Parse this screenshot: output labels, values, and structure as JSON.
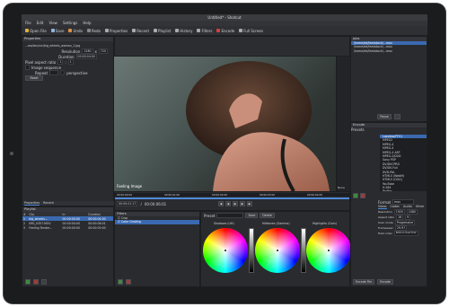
{
  "window": {
    "title": "Untitled* - Shotcut"
  },
  "menu": [
    "File",
    "Edit",
    "View",
    "Settings",
    "Help"
  ],
  "toolbar": [
    {
      "label": "Open File",
      "icon": "folder-icon",
      "color": "#e0b040"
    },
    {
      "label": "Save",
      "icon": "save-icon",
      "color": "#8fb3e0"
    },
    {
      "label": "Undo",
      "icon": "undo-icon",
      "color": "#e09040"
    },
    {
      "label": "Redo",
      "icon": "redo-icon",
      "color": "#888888"
    },
    {
      "label": "Properties",
      "icon": "properties-icon",
      "color": "#aaaaaa"
    },
    {
      "label": "Recent",
      "icon": "recent-icon",
      "color": "#aaaaaa"
    },
    {
      "label": "Playlist",
      "icon": "playlist-icon",
      "color": "#aaaaaa"
    },
    {
      "label": "History",
      "icon": "history-icon",
      "color": "#aaaaaa"
    },
    {
      "label": "Filters",
      "icon": "filters-icon",
      "color": "#aaaaaa"
    },
    {
      "label": "Encode",
      "icon": "encode-icon",
      "color": "#d04040"
    },
    {
      "label": "Full Screen",
      "icon": "fullscreen-icon",
      "color": "#aaaaaa"
    }
  ],
  "properties": {
    "title": "Properties",
    "file": "...ws/doc/src/big_wheels_woman_1.jpg",
    "resolution_label": "Resolution",
    "res_w": "1280",
    "res_h": "720",
    "duration_label": "Duration",
    "duration": "00:00:04:00",
    "pixel_aspect_label": "Pixel aspect ratio",
    "par_a": "1",
    "par_b": "1",
    "image_seq_label": "Image sequence",
    "repeat_label": "Repeat",
    "perspective_label": "perspective",
    "reset": "Reset"
  },
  "left_tabs": [
    "Properties",
    "Recent"
  ],
  "playlist": {
    "title": "Playlist",
    "headers": [
      "#",
      "Clip",
      "In",
      "Duration"
    ],
    "rows": [
      [
        "1",
        "big_wheels...",
        "00:00:00:00",
        "00:00:04:00"
      ],
      [
        "2",
        "IMG_0357.MOV",
        "00:00:00:00",
        "00:00:06:01"
      ],
      [
        "3",
        "Feeling Tender...",
        "00:00:00:00",
        "00:00:05:00"
      ]
    ]
  },
  "viewer": {
    "overlay_text": "Feeling Image",
    "timecode_current": "00:00:01:17",
    "timecode_total": "00:00:06:01",
    "ruler_marks": [
      "00:00:00:00",
      "00:00:01:00",
      "00:00:02:00",
      "00:00:03:00",
      "00:00:04:00"
    ],
    "scope_label": "None"
  },
  "filters": {
    "title": "Filters",
    "items": [
      "Crop",
      "Color Grading"
    ],
    "selected": 1
  },
  "color_grading": {
    "preset_label": "Preset",
    "save": "Save",
    "delete": "Delete",
    "wheels": [
      "Shadows (Lift)",
      "Midtones (Gamma)",
      "Highlights (Gain)"
    ]
  },
  "jobs": {
    "title": "Jobs",
    "items": [
      "/home/dd/feedstock/...mov",
      "/home/dd/feedstock/...mov",
      "/home/dd/feedstock/...mov"
    ],
    "pause": "Pause"
  },
  "encode": {
    "title": "Encode",
    "presets_label": "Presets",
    "presets": [
      "Lossless/FFV1",
      "MPEG2",
      "MPEG-4",
      "MPEG-4",
      "MPEG-4 ASP",
      "MPEG-2/DVD",
      "Sony PSP",
      "DV/DVCPRO",
      "DV/DV-Full",
      "DVD-PAL",
      "HTML5 (WebM)",
      "HTML5 (OGG)",
      "YouTube",
      "H.264",
      "ProRes"
    ],
    "selected": 0,
    "format_label": "Format",
    "format": "mov",
    "subtabs": [
      "Video",
      "Codec",
      "Audio",
      "Other"
    ],
    "resolution_label": "Resolution",
    "res_w": "1920",
    "res_h": "1080",
    "aspect_label": "Aspect ratio",
    "aspect_a": "16",
    "aspect_b": "9",
    "scan_label": "Scan mode",
    "scan": "Progressive",
    "fps_label": "Frames/sec",
    "fps": "29.97",
    "field_label": "Field order",
    "field": "Bottom Field First",
    "encode_file": "Encode File",
    "encode_btn": "Encode"
  }
}
